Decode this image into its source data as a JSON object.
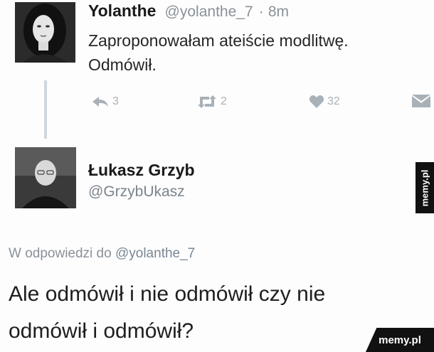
{
  "tweet": {
    "author_name": "Yolanthe",
    "author_handle": "@yolanthe_7",
    "separator": "·",
    "time": "8m",
    "text_line1": "Zaproponowałam ateiście modlitwę.",
    "text_line2": "Odmówił.",
    "reply_count": "3",
    "retweet_count": "2",
    "like_count": "32"
  },
  "reply_account": {
    "name": "Łukasz Grzyb",
    "handle": "@GrzybUkasz"
  },
  "reply": {
    "in_reply_prefix": "W odpowiedzi do",
    "in_reply_handle": "@yolanthe_7",
    "text_line1": "Ale odmówił i nie odmówił czy nie",
    "text_line2": "odmówił i odmówił?"
  },
  "watermark": {
    "side": "memy.pl",
    "corner": "memy.pl"
  },
  "icons": {
    "reply": "reply-icon",
    "retweet": "retweet-icon",
    "like": "heart-icon",
    "dm": "envelope-icon"
  },
  "colors": {
    "muted": "#8a9199",
    "action_icon": "#a9b1b8",
    "thread_line": "#cfd7de",
    "watermark_bg": "#111111"
  }
}
